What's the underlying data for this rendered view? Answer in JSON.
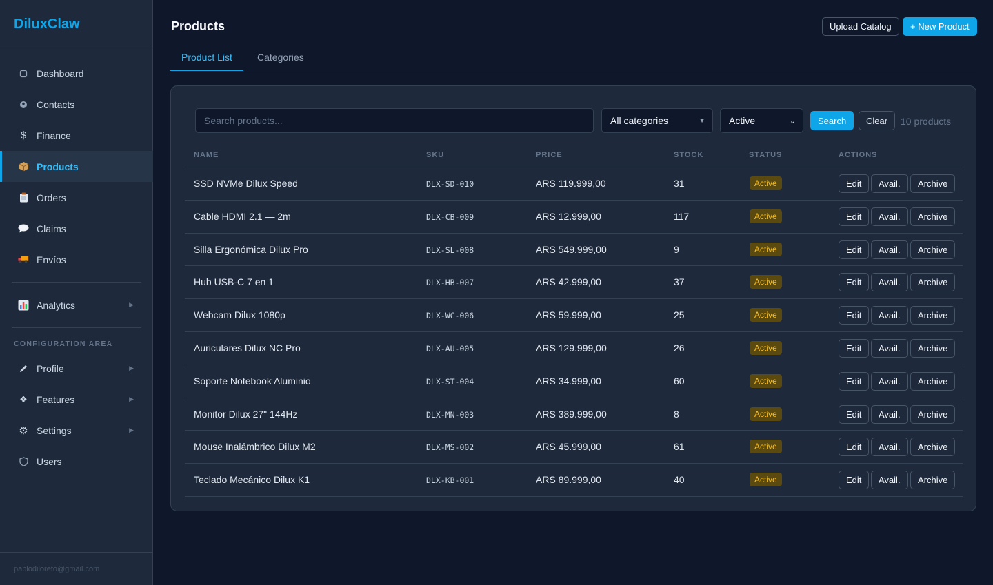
{
  "brand": "DiluxClaw",
  "sidebar": {
    "items": [
      {
        "label": "Dashboard",
        "icon": "square-icon"
      },
      {
        "label": "Contacts",
        "icon": "person-icon"
      },
      {
        "label": "Finance",
        "icon": "dollar-icon"
      },
      {
        "label": "Products",
        "icon": "package-icon",
        "active": true
      },
      {
        "label": "Orders",
        "icon": "clipboard-icon"
      },
      {
        "label": "Claims",
        "icon": "speech-bubble-icon"
      },
      {
        "label": "Envíos",
        "icon": "truck-icon"
      }
    ],
    "analytics": {
      "label": "Analytics",
      "icon": "bar-chart-icon"
    },
    "config_label": "CONFIGURATION AREA",
    "config_items": [
      {
        "label": "Profile",
        "icon": "pencil-icon",
        "expandable": true
      },
      {
        "label": "Features",
        "icon": "diamond-icon",
        "expandable": true
      },
      {
        "label": "Settings",
        "icon": "gear-icon",
        "expandable": true
      },
      {
        "label": "Users",
        "icon": "shield-icon",
        "expandable": false
      }
    ],
    "footer_email": "pablodiloreto@gmail.com"
  },
  "header": {
    "title": "Products",
    "upload_label": "Upload Catalog",
    "new_label": "+ New Product"
  },
  "tabs": [
    {
      "label": "Product List",
      "active": true
    },
    {
      "label": "Categories",
      "active": false
    }
  ],
  "filters": {
    "search_placeholder": "Search products...",
    "category": "All categories",
    "status": "Active",
    "search_label": "Search",
    "clear_label": "Clear",
    "count": "10 products"
  },
  "table": {
    "columns": [
      "NAME",
      "SKU",
      "PRICE",
      "STOCK",
      "STATUS",
      "ACTIONS"
    ],
    "actions": [
      "Edit",
      "Avail.",
      "Archive"
    ],
    "rows": [
      {
        "name": "SSD NVMe Dilux Speed",
        "sku": "DLX-SD-010",
        "price": "ARS 119.999,00",
        "stock": "31",
        "status": "Active"
      },
      {
        "name": "Cable HDMI 2.1 — 2m",
        "sku": "DLX-CB-009",
        "price": "ARS 12.999,00",
        "stock": "117",
        "status": "Active"
      },
      {
        "name": "Silla Ergonómica Dilux Pro",
        "sku": "DLX-SL-008",
        "price": "ARS 549.999,00",
        "stock": "9",
        "status": "Active"
      },
      {
        "name": "Hub USB-C 7 en 1",
        "sku": "DLX-HB-007",
        "price": "ARS 42.999,00",
        "stock": "37",
        "status": "Active"
      },
      {
        "name": "Webcam Dilux 1080p",
        "sku": "DLX-WC-006",
        "price": "ARS 59.999,00",
        "stock": "25",
        "status": "Active"
      },
      {
        "name": "Auriculares Dilux NC Pro",
        "sku": "DLX-AU-005",
        "price": "ARS 129.999,00",
        "stock": "26",
        "status": "Active"
      },
      {
        "name": "Soporte Notebook Aluminio",
        "sku": "DLX-ST-004",
        "price": "ARS 34.999,00",
        "stock": "60",
        "status": "Active"
      },
      {
        "name": "Monitor Dilux 27\" 144Hz",
        "sku": "DLX-MN-003",
        "price": "ARS 389.999,00",
        "stock": "8",
        "status": "Active"
      },
      {
        "name": "Mouse Inalámbrico Dilux M2",
        "sku": "DLX-MS-002",
        "price": "ARS 45.999,00",
        "stock": "61",
        "status": "Active"
      },
      {
        "name": "Teclado Mecánico Dilux K1",
        "sku": "DLX-KB-001",
        "price": "ARS 89.999,00",
        "stock": "40",
        "status": "Active"
      }
    ]
  },
  "colors": {
    "accent": "#0ea5e9",
    "background": "#0f172a",
    "panel": "#1e293b",
    "badge_text": "#fbbf24",
    "badge_bg": "#5b4a10"
  }
}
